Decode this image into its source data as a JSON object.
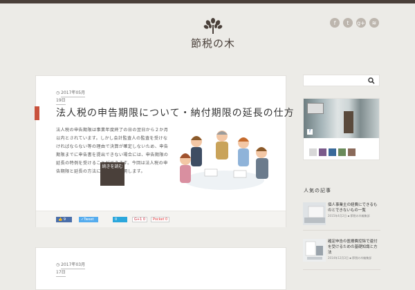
{
  "header": {
    "logo_text": "節税の木",
    "social_icons": [
      {
        "name": "facebook-icon",
        "glyph": "f"
      },
      {
        "name": "twitter-icon",
        "glyph": "t"
      },
      {
        "name": "googleplus-icon",
        "glyph": "g+"
      },
      {
        "name": "rss-icon",
        "glyph": "≋"
      }
    ]
  },
  "posts": [
    {
      "date_line1": "2017年05月",
      "date_line2": "19日",
      "title": "法人税の申告期限について・納付期限の延長の仕方",
      "excerpt": "法人税の申告期限は事業年度終了の日の翌日から２か月以内とされています。しかし会計監査人の監査を受けなければならない等の理由で決算が確定しないため、申告期限までに申告書を提出できない場合には、申告期限の延長の特例を受けることができます。今回は法人税の申告期限と延長の方法についてご説明します。",
      "more_label": "続きを読む",
      "share": {
        "fb_count": "9",
        "tweet_label": "Tweet",
        "hatena_count": "0",
        "gplus_label": "G+1",
        "gplus_count": "0",
        "pocket_label": "Pocket",
        "pocket_count": "0"
      }
    },
    {
      "date_line1": "2017年03月",
      "date_line2": "17日"
    }
  ],
  "sidebar": {
    "search_placeholder": "",
    "section_title": "人気の記事",
    "popular": [
      {
        "title": "個人事業主の経費にできるものとできないもの一覧",
        "date": "2015年4月2日 ▪ 節税の木編集部"
      },
      {
        "title": "確定申告の医療費控除で還付を受けるための基礎知識と方法",
        "date": "2014年12月3日 ▪ 節税の木編集部"
      }
    ]
  },
  "colors": {
    "accent": "#c8523d",
    "dark": "#4a403a",
    "facebook": "#4a6ea9",
    "twitter": "#55acee"
  }
}
